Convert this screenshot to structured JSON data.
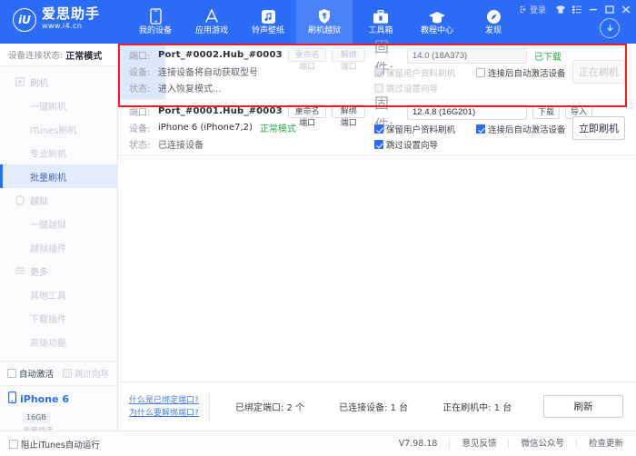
{
  "window": {
    "login_label": "登录",
    "controls": [
      "skin-icon",
      "menu-icon",
      "minimize",
      "maximize",
      "close"
    ]
  },
  "logo": {
    "mark": "iU",
    "title": "爱思助手",
    "url": "www.i4.cn"
  },
  "nav": {
    "items": [
      {
        "label": "我的设备",
        "icon": "phone-icon",
        "active": false
      },
      {
        "label": "应用游戏",
        "icon": "appstore-icon",
        "active": false
      },
      {
        "label": "铃声壁纸",
        "icon": "music-icon",
        "active": false
      },
      {
        "label": "刷机越狱",
        "icon": "shield-key-icon",
        "active": true
      },
      {
        "label": "工具箱",
        "icon": "toolbox-icon",
        "active": false
      },
      {
        "label": "教程中心",
        "icon": "graduation-cap-icon",
        "active": false
      },
      {
        "label": "发现",
        "icon": "compass-icon",
        "active": false
      }
    ],
    "download_icon": "download-circle-icon"
  },
  "sidebar": {
    "status_label": "设备连接状态:",
    "status_value": "正常模式",
    "groups": [
      {
        "label": "刷机",
        "icon": "flash-icon",
        "items": [
          {
            "label": "一键刷机",
            "active": false
          },
          {
            "label": "iTunes刷机",
            "active": false
          },
          {
            "label": "专业刷机",
            "active": false
          },
          {
            "label": "批量刷机",
            "active": true
          }
        ]
      },
      {
        "label": "越狱",
        "icon": "jailbreak-icon",
        "items": [
          {
            "label": "一键越狱",
            "active": false
          },
          {
            "label": "越狱插件",
            "active": false
          }
        ]
      },
      {
        "label": "更多",
        "icon": "more-icon",
        "items": [
          {
            "label": "其他工具",
            "active": false
          },
          {
            "label": "下载插件",
            "active": false
          },
          {
            "label": "高级功能",
            "active": false
          }
        ]
      }
    ],
    "checks": [
      {
        "label": "自动激活",
        "checked": false,
        "disabled": false
      },
      {
        "label": "跳过向导",
        "checked": false,
        "disabled": true
      }
    ],
    "device": {
      "name": "iPhone 6",
      "capacity": "16GB",
      "source": "爱思助手"
    }
  },
  "rows": [
    {
      "port_label": "端口:",
      "port_value": "Port_#0002.Hub_#0003",
      "rename_btn": "重命名端口",
      "unbind_btn": "解绑端口",
      "buttons_disabled": true,
      "device_label": "设备:",
      "device_value": "连接设备将自动获取型号",
      "device_mode": "",
      "state_label": "状态:",
      "state_value": "进入恢复模式...",
      "firmware_label": "固件:",
      "firmware_value": "14.0 (18A373)",
      "firmware_status": "已下载",
      "fw_btn1": "",
      "fw_btn2": "",
      "checks": [
        {
          "label": "保留用户资料刷机",
          "checked": true,
          "disabled": true
        },
        {
          "label": "连接后自动激活设备",
          "checked": false,
          "disabled": false
        },
        {
          "label": "跳过设置向导",
          "checked": false,
          "disabled": true
        }
      ],
      "action": "正在刷机",
      "action_disabled": true,
      "progress": true
    },
    {
      "port_label": "端口:",
      "port_value": "Port_#0001.Hub_#0003",
      "rename_btn": "重命名端口",
      "unbind_btn": "解绑端口",
      "buttons_disabled": false,
      "device_label": "设备:",
      "device_value": "iPhone 6 (iPhone7,2)",
      "device_mode": "正常模式",
      "state_label": "状态:",
      "state_value": "已连接设备",
      "firmware_label": "固件:",
      "firmware_value": "12.4.8 (16G201)",
      "firmware_status": "",
      "fw_btn1": "下载",
      "fw_btn2": "导入",
      "checks": [
        {
          "label": "保留用户资料刷机",
          "checked": true,
          "disabled": false
        },
        {
          "label": "连接后自动激活设备",
          "checked": true,
          "disabled": false
        },
        {
          "label": "跳过设置向导",
          "checked": true,
          "disabled": false
        }
      ],
      "action": "立即刷机",
      "action_disabled": false,
      "progress": false
    }
  ],
  "statusbar": {
    "link1": "什么是已绑定端口?",
    "link2": "为什么要解绑端口?",
    "count_bound": "已绑定端口: 2 个",
    "count_connected": "已连接设备: 1 台",
    "count_flashing": "正在刷机中: 1 台",
    "refresh": "刷新"
  },
  "footer": {
    "itunes_check": "阻止iTunes自动运行",
    "version": "V7.98.18",
    "feedback": "意见反馈",
    "wechat": "微信公众号",
    "update": "检查更新"
  },
  "colors": {
    "brand_blue": "#2d6cf6",
    "active_nav": "#4a82f8",
    "green": "#29a745",
    "annotation_red": "#ee1c25",
    "link_blue": "#4a7fe0"
  }
}
